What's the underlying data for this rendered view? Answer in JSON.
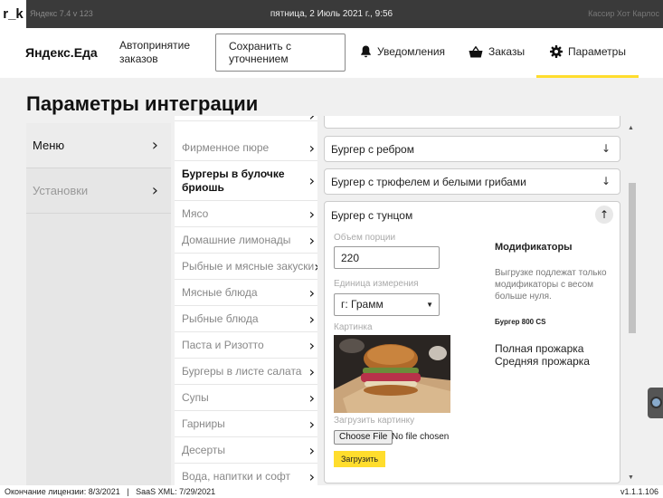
{
  "statusbar": {
    "logo": "r_k",
    "left_text": "Яндекс 7.4 v 123",
    "datetime": "пятница, 2 Июль 2021 г., 9:56",
    "right_text": "Кассир Хот Карлос"
  },
  "nav": {
    "brand": "Яндекс.Еда",
    "auto_accept": "Автопринятие заказов",
    "save_button": "Сохранить с уточнением",
    "notifications": "Уведомления",
    "orders": "Заказы",
    "settings": "Параметры"
  },
  "page_title": "Параметры интеграции",
  "left_menu": [
    {
      "label": "Меню",
      "active": true
    },
    {
      "label": "Установки",
      "active": false
    }
  ],
  "categories": [
    {
      "label": "Фирменное пюре",
      "active": false
    },
    {
      "label": "Бургеры в булочке бриошь",
      "active": true
    },
    {
      "label": "Мясо",
      "active": false
    },
    {
      "label": "Домашние лимонады",
      "active": false
    },
    {
      "label": "Рыбные и мясные закуски",
      "active": false
    },
    {
      "label": "Мясные блюда",
      "active": false
    },
    {
      "label": "Рыбные блюда",
      "active": false
    },
    {
      "label": "Паста и Ризотто",
      "active": false
    },
    {
      "label": "Бургеры в листе салата",
      "active": false
    },
    {
      "label": "Супы",
      "active": false
    },
    {
      "label": "Гарниры",
      "active": false
    },
    {
      "label": "Десерты",
      "active": false
    },
    {
      "label": "Вода, напитки и софт",
      "active": false
    }
  ],
  "products": [
    {
      "title": "Бургер с ребром"
    },
    {
      "title": "Бургер с трюфелем и белыми грибами"
    }
  ],
  "expanded_product": {
    "title": "Бургер с тунцом",
    "portion_label": "Объем порции",
    "portion_value": "220",
    "unit_label": "Единица измерения",
    "unit_value": "г: Грамм",
    "image_label": "Картинка",
    "upload_label": "Загрузить картинку",
    "choose_file": "Choose File",
    "no_file": "No file chosen",
    "upload_button": "Загрузить",
    "modifiers_title": "Модификаторы",
    "modifiers_note": "Выгрузке подлежат только модификаторы с весом больше нуля.",
    "modifier_product": "Бургер 800 CS",
    "modifier_options": [
      "Полная прожарка",
      "Средняя прожарка"
    ]
  },
  "footer": {
    "license": "Окончание лицензии: 8/3/2021   |   SaaS XML: 7/29/2021",
    "version": "v1.1.1.106"
  }
}
